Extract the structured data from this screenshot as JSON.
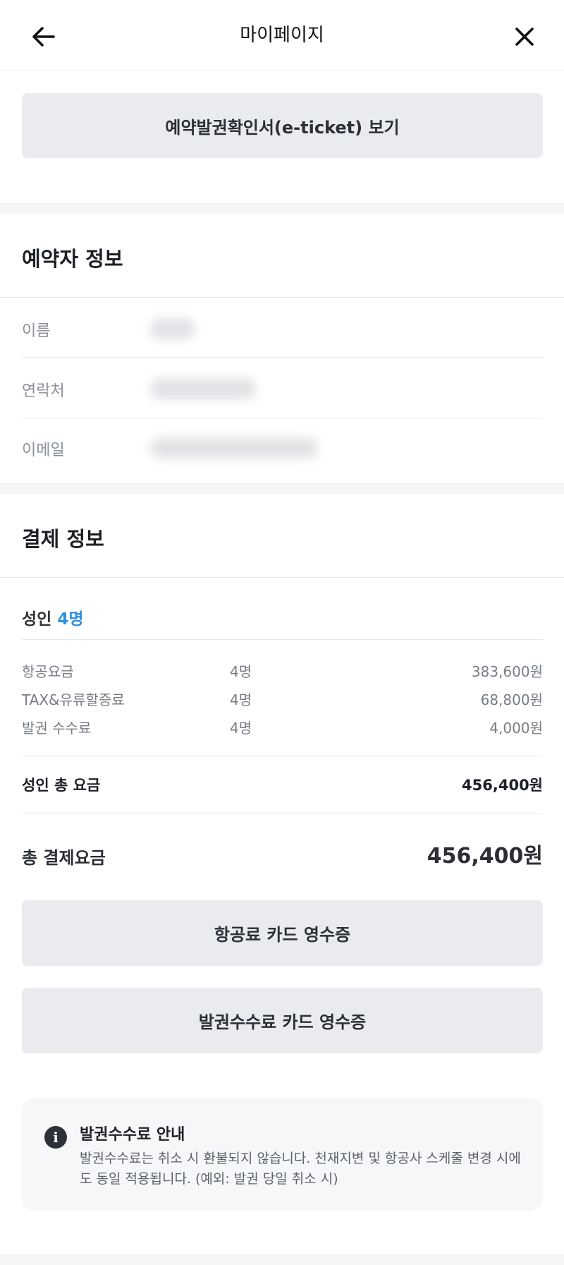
{
  "header": {
    "title": "마이페이지",
    "back_icon": "arrow-left-icon",
    "close_icon": "close-icon"
  },
  "eticket_button": "예약발권확인서(e-ticket) 보기",
  "booker": {
    "title": "예약자 정보",
    "rows": [
      {
        "label": "이름"
      },
      {
        "label": "연락처"
      },
      {
        "label": "이메일"
      }
    ]
  },
  "payment": {
    "title": "결제 정보",
    "adult_label": "성인",
    "adult_count": "4명",
    "fees": [
      {
        "name": "항공요금",
        "qty": "4명",
        "amount": "383,600원"
      },
      {
        "name": "TAX&유류할증료",
        "qty": "4명",
        "amount": "68,800원"
      },
      {
        "name": "발권 수수료",
        "qty": "4명",
        "amount": "4,000원"
      }
    ],
    "adult_total_label": "성인 총 요금",
    "adult_total": "456,400원",
    "grand_total_label": "총 결제요금",
    "grand_total": "456,400원",
    "accent_color": "#2f8fde"
  },
  "receipts": {
    "airfare_button": "항공료 카드 영수증",
    "fee_button": "발권수수료 카드 영수증"
  },
  "notice": {
    "icon": "info-icon",
    "title": "발권수수료 안내",
    "text": "발권수수료는 취소 시 환불되지 않습니다. 천재지변 및 항공사 스케줄 변경 시에도 동일 적용됩니다. (예외: 발권 당일 취소 시)"
  }
}
